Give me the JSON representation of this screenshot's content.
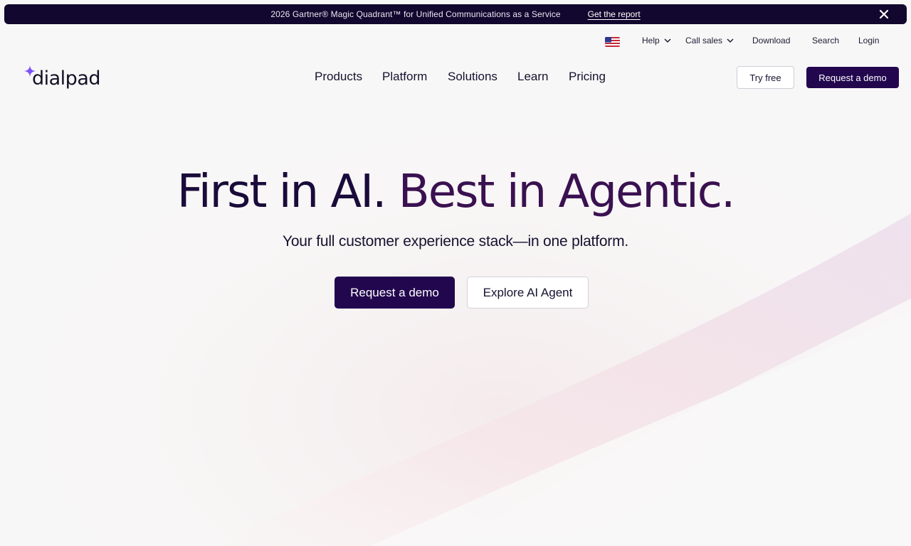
{
  "banner": {
    "text": "2026 Gartner® Magic Quadrant™ for Unified Communications as a Service",
    "link": "Get the report",
    "close_icon": "close-icon"
  },
  "utility": {
    "flag_icon": "us-flag-icon",
    "help": "Help",
    "call_sales": "Call sales",
    "download": "Download",
    "search": "Search",
    "login": "Login"
  },
  "brand": {
    "logo_text": "dialpad",
    "logo_icon": "sparkle-icon"
  },
  "nav": {
    "items": [
      "Products",
      "Platform",
      "Solutions",
      "Learn",
      "Pricing"
    ],
    "try_free": "Try free",
    "request_demo": "Request a demo"
  },
  "hero": {
    "title_part1": "First in AI.",
    "title_part2": "Best in Agentic.",
    "subtitle": "Your full customer experience stack—in one platform.",
    "primary_cta": "Request a demo",
    "secondary_cta": "Explore AI Agent"
  },
  "colors": {
    "brand_dark": "#22074f",
    "banner_bg": "#12072e",
    "accent_purple": "#7c52ff"
  }
}
